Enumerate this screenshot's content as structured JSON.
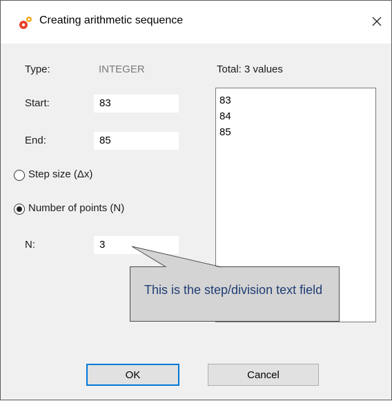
{
  "window": {
    "title": "Creating arithmetic sequence",
    "icon": "gears-icon",
    "close_icon": "close-icon"
  },
  "form": {
    "type_label": "Type:",
    "type_value": "INTEGER",
    "start_label": "Start:",
    "start_value": "83",
    "end_label": "End:",
    "end_value": "85",
    "step_option_label": "Step size (Δx)",
    "step_option_selected": false,
    "points_option_label": "Number of points (N)",
    "points_option_selected": true,
    "n_label": "N:",
    "n_value": "3"
  },
  "values_panel": {
    "total_label": "Total: 3 values",
    "items": [
      "83",
      "84",
      "85"
    ]
  },
  "callout": {
    "text": "This is the step/division text field"
  },
  "buttons": {
    "ok_label": "OK",
    "cancel_label": "Cancel"
  },
  "colors": {
    "accent": "#0078d7",
    "callout_text": "#1f3d73",
    "callout_fill": "#d4d4d4"
  }
}
